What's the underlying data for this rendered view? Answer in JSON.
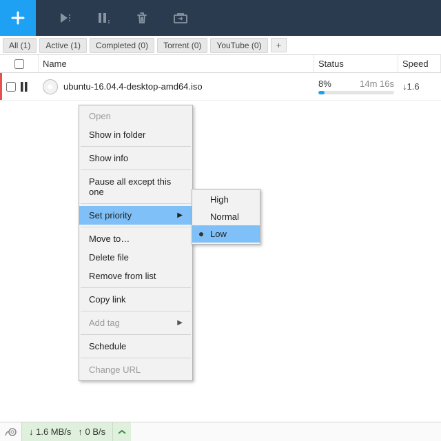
{
  "tabs": [
    {
      "label": "All (1)"
    },
    {
      "label": "Active (1)"
    },
    {
      "label": "Completed (0)"
    },
    {
      "label": "Torrent (0)"
    },
    {
      "label": "YouTube (0)"
    }
  ],
  "columns": {
    "name": "Name",
    "status": "Status",
    "speed": "Speed"
  },
  "row": {
    "name": "ubuntu-16.04.4-desktop-amd64.iso",
    "percent": "8%",
    "eta": "14m 16s",
    "progress_pct": 8,
    "speed": "↓1.6"
  },
  "statusbar": {
    "down": "↓  1.6 MB/s",
    "up": "↑  0 B/s"
  },
  "context_menu": {
    "open": "Open",
    "show_in_folder": "Show in folder",
    "show_info": "Show info",
    "pause_except": "Pause all except this one",
    "set_priority": "Set priority",
    "move_to": "Move to…",
    "delete_file": "Delete file",
    "remove_list": "Remove from list",
    "copy_link": "Copy link",
    "add_tag": "Add tag",
    "schedule": "Schedule",
    "change_url": "Change URL"
  },
  "priority_sub": {
    "high": "High",
    "normal": "Normal",
    "low": "Low"
  },
  "tab_add": "+"
}
